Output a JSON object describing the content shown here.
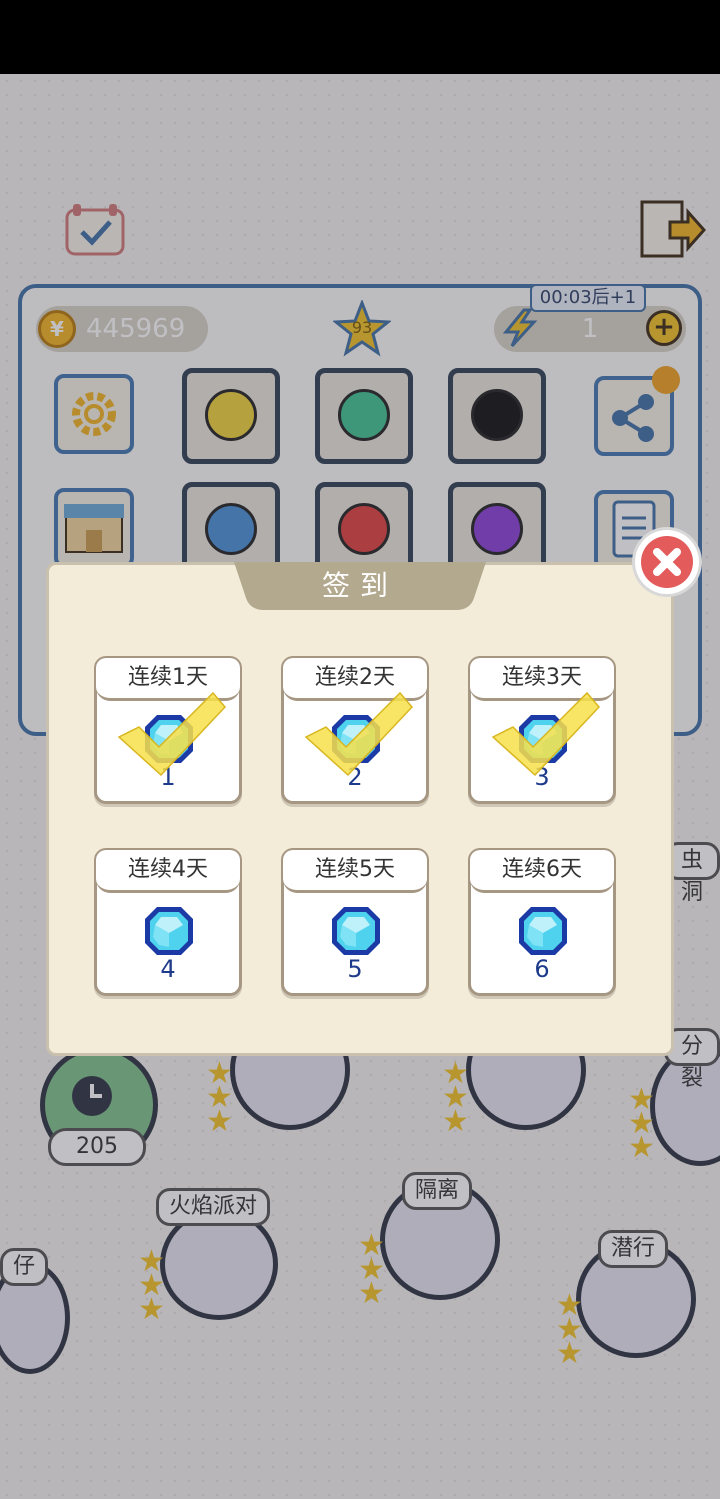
{
  "header": {
    "coins": "445969",
    "level": "93",
    "energy_timer": "00:03后+1",
    "energy": "1",
    "plus_symbol": "+"
  },
  "dialog": {
    "title": "签到",
    "days": [
      {
        "label": "连续1天",
        "reward": "1",
        "claimed": true
      },
      {
        "label": "连续2天",
        "reward": "2",
        "claimed": true
      },
      {
        "label": "连续3天",
        "reward": "3",
        "claimed": true
      },
      {
        "label": "连续4天",
        "reward": "4",
        "claimed": false
      },
      {
        "label": "连续5天",
        "reward": "5",
        "claimed": false
      },
      {
        "label": "连续6天",
        "reward": "6",
        "claimed": false
      }
    ]
  },
  "background": {
    "timer_cost": "205",
    "labels": {
      "flame_party": "火焰派对",
      "isolation": "隔离",
      "stealth": "潜行",
      "split": "分裂",
      "hole": "虫洞",
      "kid": "仔"
    }
  },
  "colors": {
    "accent_blue": "#3f6fa6",
    "dialog_bg": "#f3ecd9",
    "gem": "#4fd2ee",
    "check": "#f7e04a",
    "close_red": "#e35b5b"
  }
}
